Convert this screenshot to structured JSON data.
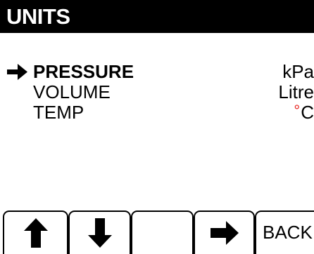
{
  "screen": {
    "title": "UNITS"
  },
  "menu": {
    "items": [
      {
        "label": "PRESSURE",
        "value": "kPa",
        "selected": true
      },
      {
        "label": "VOLUME",
        "value": "Litre",
        "selected": false
      },
      {
        "label": "TEMP",
        "value_symbol": "°",
        "value": "C",
        "selected": false
      }
    ],
    "pointer_icon": "right-arrow-icon"
  },
  "softkeys": [
    {
      "icon": "up-arrow-icon"
    },
    {
      "icon": "down-arrow-icon"
    },
    {
      "label": ""
    },
    {
      "icon": "right-arrow-icon"
    },
    {
      "label": "BACK"
    }
  ],
  "colors": {
    "title_bg": "#000000",
    "title_fg": "#ffffff",
    "degree_symbol": "#e8231e"
  }
}
